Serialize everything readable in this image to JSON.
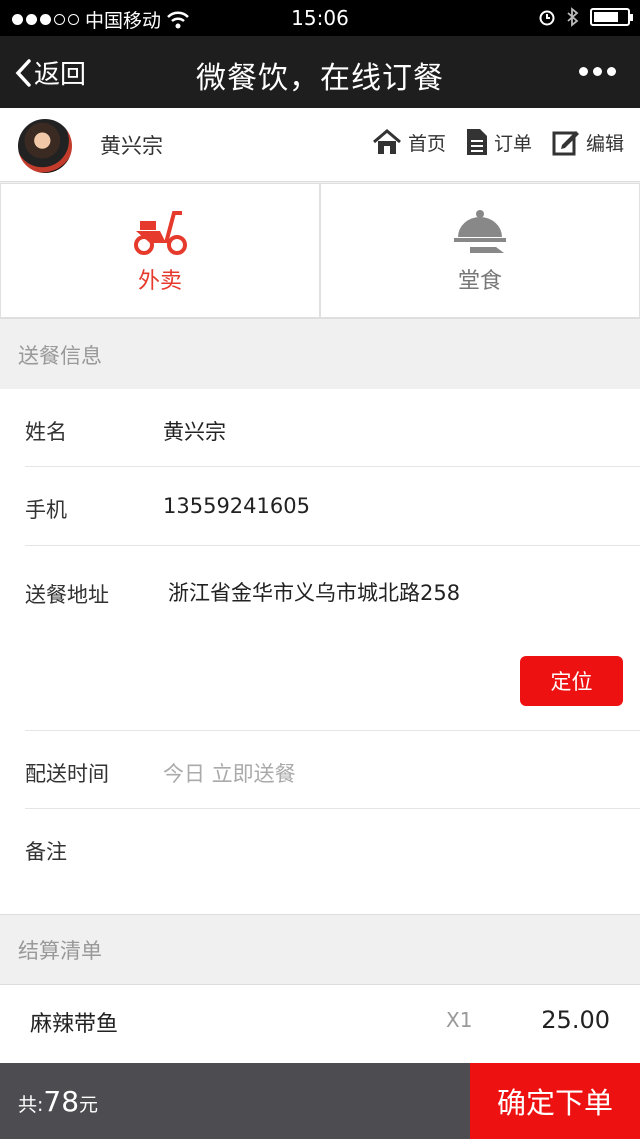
{
  "status_bar": {
    "carrier": "中国移动",
    "time": "15:06"
  },
  "nav": {
    "back_label": "返回",
    "title": "微餐饮，在线订餐"
  },
  "user": {
    "name": "黄兴宗"
  },
  "top_links": [
    {
      "label": "首页",
      "icon": "home-icon"
    },
    {
      "label": "订单",
      "icon": "document-icon"
    },
    {
      "label": "编辑",
      "icon": "edit-icon"
    }
  ],
  "modes": [
    {
      "label": "外卖",
      "icon": "scooter-icon",
      "active": true
    },
    {
      "label": "堂食",
      "icon": "cloche-icon",
      "active": false
    }
  ],
  "delivery_section": {
    "title": "送餐信息",
    "name_label": "姓名",
    "name_value": "黄兴宗",
    "phone_label": "手机",
    "phone_value": "13559241605",
    "address_label": "送餐地址",
    "address_value": "浙江省金华市义乌市城北路258",
    "locate_label": "定位",
    "time_label": "配送时间",
    "time_placeholder": "今日 立即送餐",
    "note_label": "备注"
  },
  "bill_section": {
    "title": "结算清单",
    "items": [
      {
        "name": "麻辣带鱼",
        "qty": "X1",
        "price": "25.00"
      }
    ]
  },
  "bottom": {
    "total_prefix": "共:",
    "total_amount": "78",
    "total_unit": "元",
    "confirm_label": "确定下单"
  },
  "colors": {
    "accent": "#ee1111",
    "mode_active": "#e53a2c",
    "bottom_bar": "#4c4c51",
    "nav_bg": "#1e1e1e"
  }
}
